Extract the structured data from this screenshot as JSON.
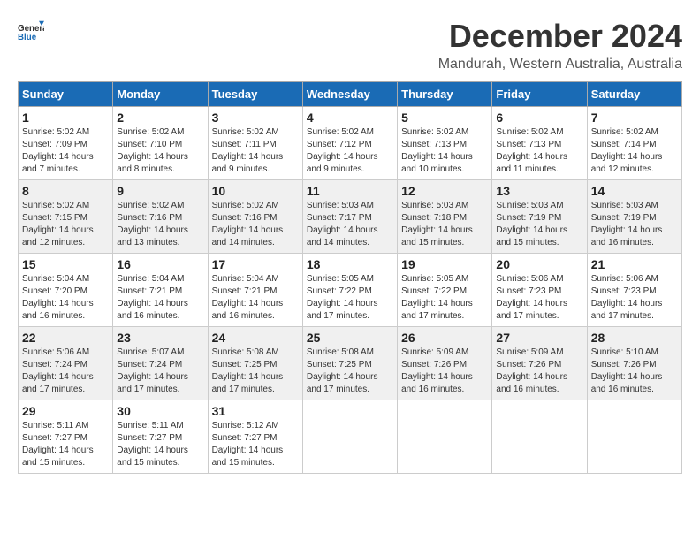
{
  "logo": {
    "general": "General",
    "blue": "Blue"
  },
  "header": {
    "title": "December 2024",
    "subtitle": "Mandurah, Western Australia, Australia"
  },
  "columns": [
    "Sunday",
    "Monday",
    "Tuesday",
    "Wednesday",
    "Thursday",
    "Friday",
    "Saturday"
  ],
  "weeks": [
    [
      {
        "day": "1",
        "info": "Sunrise: 5:02 AM\nSunset: 7:09 PM\nDaylight: 14 hours\nand 7 minutes."
      },
      {
        "day": "2",
        "info": "Sunrise: 5:02 AM\nSunset: 7:10 PM\nDaylight: 14 hours\nand 8 minutes."
      },
      {
        "day": "3",
        "info": "Sunrise: 5:02 AM\nSunset: 7:11 PM\nDaylight: 14 hours\nand 9 minutes."
      },
      {
        "day": "4",
        "info": "Sunrise: 5:02 AM\nSunset: 7:12 PM\nDaylight: 14 hours\nand 9 minutes."
      },
      {
        "day": "5",
        "info": "Sunrise: 5:02 AM\nSunset: 7:13 PM\nDaylight: 14 hours\nand 10 minutes."
      },
      {
        "day": "6",
        "info": "Sunrise: 5:02 AM\nSunset: 7:13 PM\nDaylight: 14 hours\nand 11 minutes."
      },
      {
        "day": "7",
        "info": "Sunrise: 5:02 AM\nSunset: 7:14 PM\nDaylight: 14 hours\nand 12 minutes."
      }
    ],
    [
      {
        "day": "8",
        "info": "Sunrise: 5:02 AM\nSunset: 7:15 PM\nDaylight: 14 hours\nand 12 minutes."
      },
      {
        "day": "9",
        "info": "Sunrise: 5:02 AM\nSunset: 7:16 PM\nDaylight: 14 hours\nand 13 minutes."
      },
      {
        "day": "10",
        "info": "Sunrise: 5:02 AM\nSunset: 7:16 PM\nDaylight: 14 hours\nand 14 minutes."
      },
      {
        "day": "11",
        "info": "Sunrise: 5:03 AM\nSunset: 7:17 PM\nDaylight: 14 hours\nand 14 minutes."
      },
      {
        "day": "12",
        "info": "Sunrise: 5:03 AM\nSunset: 7:18 PM\nDaylight: 14 hours\nand 15 minutes."
      },
      {
        "day": "13",
        "info": "Sunrise: 5:03 AM\nSunset: 7:19 PM\nDaylight: 14 hours\nand 15 minutes."
      },
      {
        "day": "14",
        "info": "Sunrise: 5:03 AM\nSunset: 7:19 PM\nDaylight: 14 hours\nand 16 minutes."
      }
    ],
    [
      {
        "day": "15",
        "info": "Sunrise: 5:04 AM\nSunset: 7:20 PM\nDaylight: 14 hours\nand 16 minutes."
      },
      {
        "day": "16",
        "info": "Sunrise: 5:04 AM\nSunset: 7:21 PM\nDaylight: 14 hours\nand 16 minutes."
      },
      {
        "day": "17",
        "info": "Sunrise: 5:04 AM\nSunset: 7:21 PM\nDaylight: 14 hours\nand 16 minutes."
      },
      {
        "day": "18",
        "info": "Sunrise: 5:05 AM\nSunset: 7:22 PM\nDaylight: 14 hours\nand 17 minutes."
      },
      {
        "day": "19",
        "info": "Sunrise: 5:05 AM\nSunset: 7:22 PM\nDaylight: 14 hours\nand 17 minutes."
      },
      {
        "day": "20",
        "info": "Sunrise: 5:06 AM\nSunset: 7:23 PM\nDaylight: 14 hours\nand 17 minutes."
      },
      {
        "day": "21",
        "info": "Sunrise: 5:06 AM\nSunset: 7:23 PM\nDaylight: 14 hours\nand 17 minutes."
      }
    ],
    [
      {
        "day": "22",
        "info": "Sunrise: 5:06 AM\nSunset: 7:24 PM\nDaylight: 14 hours\nand 17 minutes."
      },
      {
        "day": "23",
        "info": "Sunrise: 5:07 AM\nSunset: 7:24 PM\nDaylight: 14 hours\nand 17 minutes."
      },
      {
        "day": "24",
        "info": "Sunrise: 5:08 AM\nSunset: 7:25 PM\nDaylight: 14 hours\nand 17 minutes."
      },
      {
        "day": "25",
        "info": "Sunrise: 5:08 AM\nSunset: 7:25 PM\nDaylight: 14 hours\nand 17 minutes."
      },
      {
        "day": "26",
        "info": "Sunrise: 5:09 AM\nSunset: 7:26 PM\nDaylight: 14 hours\nand 16 minutes."
      },
      {
        "day": "27",
        "info": "Sunrise: 5:09 AM\nSunset: 7:26 PM\nDaylight: 14 hours\nand 16 minutes."
      },
      {
        "day": "28",
        "info": "Sunrise: 5:10 AM\nSunset: 7:26 PM\nDaylight: 14 hours\nand 16 minutes."
      }
    ],
    [
      {
        "day": "29",
        "info": "Sunrise: 5:11 AM\nSunset: 7:27 PM\nDaylight: 14 hours\nand 15 minutes."
      },
      {
        "day": "30",
        "info": "Sunrise: 5:11 AM\nSunset: 7:27 PM\nDaylight: 14 hours\nand 15 minutes."
      },
      {
        "day": "31",
        "info": "Sunrise: 5:12 AM\nSunset: 7:27 PM\nDaylight: 14 hours\nand 15 minutes."
      },
      null,
      null,
      null,
      null
    ]
  ]
}
